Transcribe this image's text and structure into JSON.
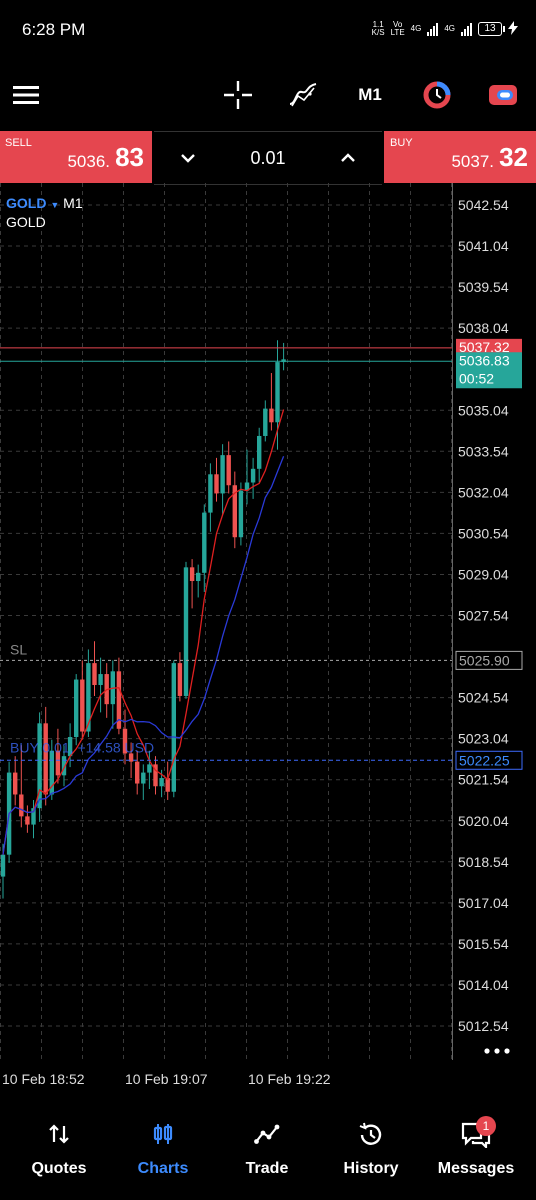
{
  "status_bar": {
    "time": "6:28 PM",
    "net_speed_top": "1.1",
    "net_speed_unit": "K/S",
    "volte_top": "Vo",
    "volte_bottom": "LTE",
    "sim1_label": "4G",
    "sim2_label": "4G",
    "battery": "13"
  },
  "toolbar": {
    "timeframe": "M1",
    "icons": [
      "menu-icon",
      "crosshair-icon",
      "indicators-icon",
      "timeframe-button",
      "one-click-trading-icon",
      "chart-settings-icon"
    ]
  },
  "trade": {
    "sell_label": "SELL",
    "sell_price_small": "5036.",
    "sell_price_big": "83",
    "buy_label": "BUY",
    "buy_price_small": "5037.",
    "buy_price_big": "32",
    "lot": "0.01"
  },
  "chart": {
    "symbol": "GOLD",
    "timeframe": "M1",
    "description": "GOLD",
    "sl_label": "SL",
    "sl_price": "5025.90",
    "position_label": "BUY 0.01, +14.58 USD",
    "position_price": "5022.25",
    "ask_price": "5037.32",
    "bid_price": "5036.83",
    "countdown": "00:52",
    "y_axis_labels": [
      "5042.54",
      "5041.04",
      "5039.54",
      "5038.04",
      "5035.04",
      "5033.54",
      "5032.04",
      "5030.54",
      "5029.04",
      "5027.54",
      "5024.54",
      "5023.04",
      "5021.54",
      "5020.04",
      "5018.54",
      "5017.04",
      "5015.54",
      "5014.04",
      "5012.54"
    ],
    "x_axis_labels": [
      "10 Feb 18:52",
      "10 Feb 19:07",
      "10 Feb 19:22"
    ],
    "colors": {
      "bull": "#26a69a",
      "bear": "#ef5350",
      "ma_fast": "#e02020",
      "ma_slow": "#2a3ad8",
      "ask_line": "#e5464f",
      "bid_line": "#26a69a",
      "grid": "#3a3a3a"
    }
  },
  "nav": {
    "items": [
      {
        "label": "Quotes",
        "icon": "quotes-icon"
      },
      {
        "label": "Charts",
        "icon": "charts-icon"
      },
      {
        "label": "Trade",
        "icon": "trade-icon"
      },
      {
        "label": "History",
        "icon": "history-icon"
      },
      {
        "label": "Messages",
        "icon": "messages-icon"
      }
    ],
    "messages_badge": "1"
  }
}
